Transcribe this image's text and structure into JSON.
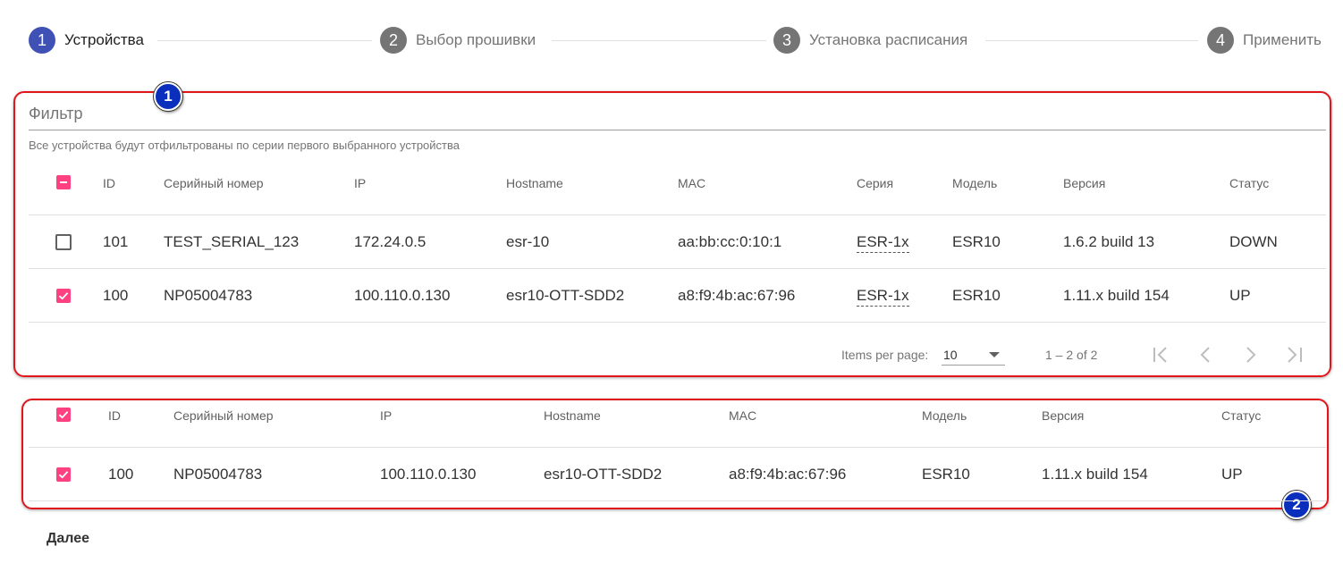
{
  "stepper": {
    "steps": [
      {
        "number": "1",
        "label": "Устройства",
        "active": true
      },
      {
        "number": "2",
        "label": "Выбор прошивки",
        "active": false
      },
      {
        "number": "3",
        "label": "Установка расписания",
        "active": false
      },
      {
        "number": "4",
        "label": "Применить",
        "active": false
      }
    ]
  },
  "colors": {
    "active_step": "#3f51b5",
    "inactive_step": "#757575",
    "checkbox": "#ff4081",
    "callout": "#e0161b",
    "marker": "#0a2fbd"
  },
  "markers": {
    "first": "1",
    "second": "2"
  },
  "filter": {
    "label": "Фильтр",
    "hint": "Все устройства будут отфильтрованы по серии первого выбранного устройства"
  },
  "devices_table": {
    "columns": [
      "ID",
      "Серийный номер",
      "IP",
      "Hostname",
      "MAC",
      "Серия",
      "Модель",
      "Версия",
      "Статус"
    ],
    "rows": [
      {
        "checked": false,
        "id": "101",
        "serial": "TEST_SERIAL_123",
        "ip": "172.24.0.5",
        "hostname": "esr-10",
        "mac": "aa:bb:cc:0:10:1",
        "series": "ESR-1x",
        "model": "ESR10",
        "version": "1.6.2 build 13",
        "status": "DOWN"
      },
      {
        "checked": true,
        "id": "100",
        "serial": "NP05004783",
        "ip": "100.110.0.130",
        "hostname": "esr10-OTT-SDD2",
        "mac": "a8:f9:4b:ac:67:96",
        "series": "ESR-1x",
        "model": "ESR10",
        "version": "1.11.x build 154",
        "status": "UP"
      }
    ],
    "paginator": {
      "items_per_page_label": "Items per page:",
      "items_per_page_value": "10",
      "range_label": "1 – 2 of 2"
    }
  },
  "selected_table": {
    "columns": [
      "ID",
      "Серийный номер",
      "IP",
      "Hostname",
      "MAC",
      "Модель",
      "Версия",
      "Статус"
    ],
    "rows": [
      {
        "checked": true,
        "id": "100",
        "serial": "NP05004783",
        "ip": "100.110.0.130",
        "hostname": "esr10-OTT-SDD2",
        "mac": "a8:f9:4b:ac:67:96",
        "model": "ESR10",
        "version": "1.11.x build 154",
        "status": "UP"
      }
    ]
  },
  "actions": {
    "next_label": "Далее"
  }
}
